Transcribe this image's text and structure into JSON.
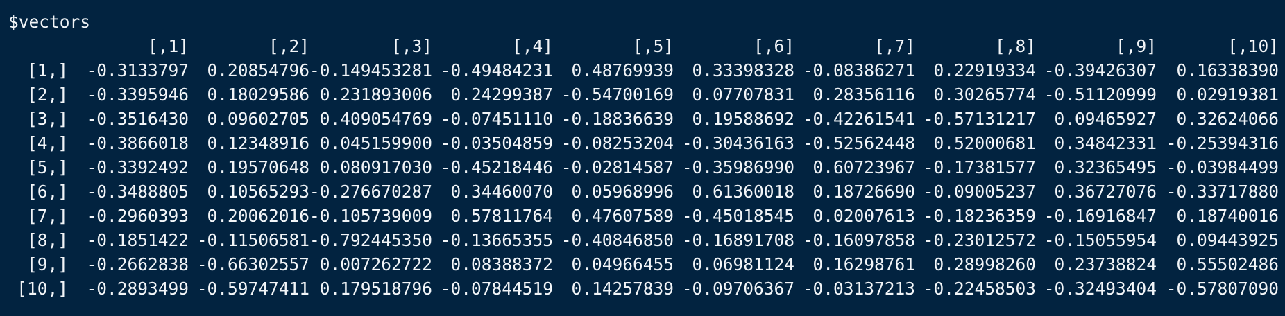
{
  "console": {
    "name_line": "$vectors",
    "columns": [
      "[,1]",
      "[,2]",
      "[,3]",
      "[,4]",
      "[,5]",
      "[,6]",
      "[,7]",
      "[,8]",
      "[,9]",
      "[,10]"
    ],
    "rows": [
      {
        "label": "[1,]",
        "values": [
          "-0.3133797",
          "0.20854796",
          "-0.149453281",
          "-0.49484231",
          "0.48769939",
          "0.33398328",
          "-0.08386271",
          "0.22919334",
          "-0.39426307",
          "0.16338390"
        ]
      },
      {
        "label": "[2,]",
        "values": [
          "-0.3395946",
          "0.18029586",
          "0.231893006",
          "0.24299387",
          "-0.54700169",
          "0.07707831",
          "0.28356116",
          "0.30265774",
          "-0.51120999",
          "0.02919381"
        ]
      },
      {
        "label": "[3,]",
        "values": [
          "-0.3516430",
          "0.09602705",
          "0.409054769",
          "-0.07451110",
          "-0.18836639",
          "0.19588692",
          "-0.42261541",
          "-0.57131217",
          "0.09465927",
          "0.32624066"
        ]
      },
      {
        "label": "[4,]",
        "values": [
          "-0.3866018",
          "0.12348916",
          "0.045159900",
          "-0.03504859",
          "-0.08253204",
          "-0.30436163",
          "-0.52562448",
          "0.52000681",
          "0.34842331",
          "-0.25394316"
        ]
      },
      {
        "label": "[5,]",
        "values": [
          "-0.3392492",
          "0.19570648",
          "0.080917030",
          "-0.45218446",
          "-0.02814587",
          "-0.35986990",
          "0.60723967",
          "-0.17381577",
          "0.32365495",
          "-0.03984499"
        ]
      },
      {
        "label": "[6,]",
        "values": [
          "-0.3488805",
          "0.10565293",
          "-0.276670287",
          "0.34460070",
          "0.05968996",
          "0.61360018",
          "0.18726690",
          "-0.09005237",
          "0.36727076",
          "-0.33717880"
        ]
      },
      {
        "label": "[7,]",
        "values": [
          "-0.2960393",
          "0.20062016",
          "-0.105739009",
          "0.57811764",
          "0.47607589",
          "-0.45018545",
          "0.02007613",
          "-0.18236359",
          "-0.16916847",
          "0.18740016"
        ]
      },
      {
        "label": "[8,]",
        "values": [
          "-0.1851422",
          "-0.11506581",
          "-0.792445350",
          "-0.13665355",
          "-0.40846850",
          "-0.16891708",
          "-0.16097858",
          "-0.23012572",
          "-0.15055954",
          "0.09443925"
        ]
      },
      {
        "label": "[9,]",
        "values": [
          "-0.2662838",
          "-0.66302557",
          "0.007262722",
          "0.08388372",
          "0.04966455",
          "0.06981124",
          "0.16298761",
          "0.28998260",
          "0.23738824",
          "0.55502486"
        ]
      },
      {
        "label": "[10,]",
        "values": [
          "-0.2893499",
          "-0.59747411",
          "0.179518796",
          "-0.07844519",
          "0.14257839",
          "-0.09706367",
          "-0.03137213",
          "-0.22458503",
          "-0.32493404",
          "-0.57807090"
        ]
      }
    ]
  },
  "colors": {
    "background": "#022340",
    "text": "#f2f5f8"
  }
}
